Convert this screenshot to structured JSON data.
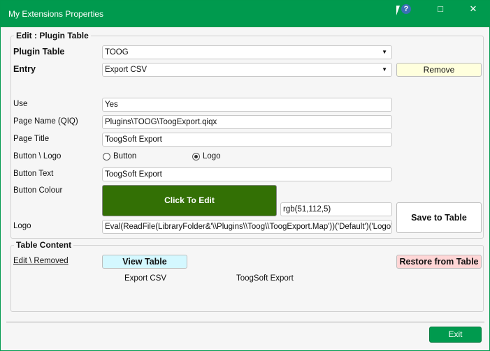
{
  "window": {
    "title": "My Extensions Properties",
    "help_icon": "?",
    "maximize_icon": "□",
    "close_icon": "✕"
  },
  "edit_group": {
    "legend": "Edit : Plugin Table",
    "plugin_table": {
      "label": "Plugin Table",
      "value": "TOOG"
    },
    "entry": {
      "label": "Entry",
      "value": "Export CSV"
    },
    "remove_label": "Remove",
    "use": {
      "label": "Use",
      "value": "Yes"
    },
    "page_name": {
      "label": "Page Name (QIQ)",
      "value": "Plugins\\TOOG\\ToogExport.qiqx"
    },
    "page_title": {
      "label": "Page Title",
      "value": "ToogSoft Export"
    },
    "button_logo": {
      "label": "Button \\ Logo",
      "options": [
        "Button",
        "Logo"
      ],
      "selected": "Logo"
    },
    "button_text": {
      "label": "Button Text",
      "value": "ToogSoft Export"
    },
    "button_colour": {
      "label": "Button Colour",
      "button_label": "Click To Edit",
      "value": "rgb(51,112,5)",
      "color": "#337005"
    },
    "logo": {
      "label": "Logo",
      "value": "Eval(ReadFile(LibraryFolder&'\\\\Plugins\\\\Toog\\\\ToogExport.Map'))('Default')('Logo')"
    },
    "save_label": "Save to Table"
  },
  "table_group": {
    "legend": "Table Content",
    "edit_removed_link": "Edit \\ Removed",
    "view_table_label": "View Table",
    "restore_label": "Restore from Table",
    "rows": [
      [
        "Export CSV",
        "ToogSoft Export"
      ]
    ]
  },
  "footer": {
    "exit_label": "Exit"
  },
  "colors": {
    "accent": "#009a4e",
    "remove": "#ffffdd",
    "view": "#d4f8ff",
    "restore": "#ffd6d6"
  }
}
